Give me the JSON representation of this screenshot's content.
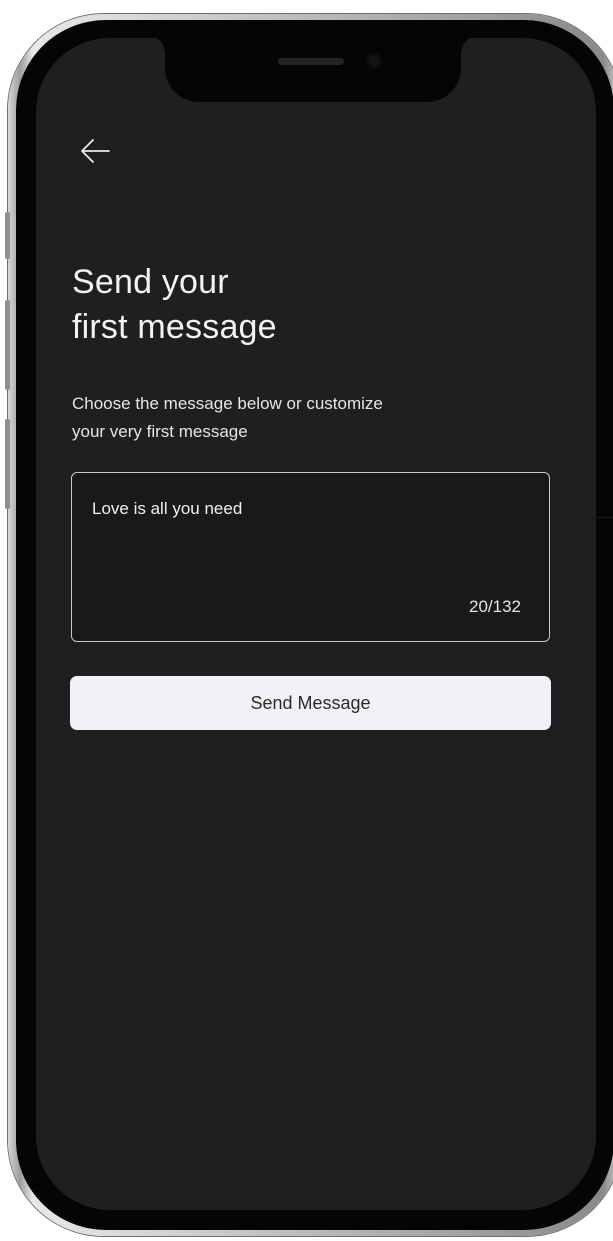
{
  "header": {
    "back_icon": "arrow-left-icon"
  },
  "title": {
    "line1": "Send your",
    "line2": "first message"
  },
  "subtitle": {
    "line1": "Choose the message below or customize",
    "line2": "your very first message"
  },
  "message_box": {
    "value": "Love is all you need",
    "char_count": "20/132"
  },
  "send_button": {
    "label": "Send Message"
  },
  "colors": {
    "screen_background": "#1e1f21",
    "text": "#f3f3f3",
    "button_background": "#f2f1f5"
  }
}
